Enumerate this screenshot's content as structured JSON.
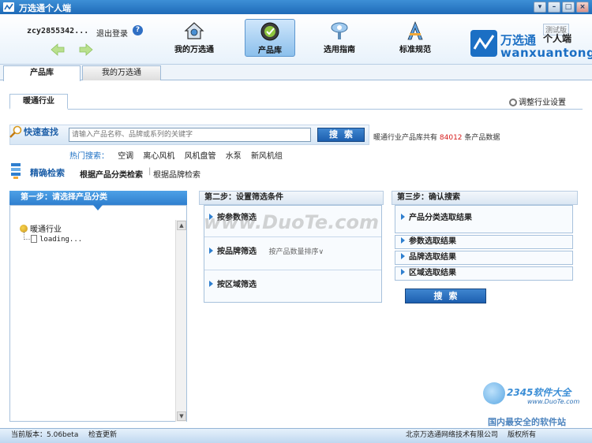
{
  "window": {
    "title": "万选通个人端"
  },
  "header": {
    "username": "zcy2855342...",
    "logout_label": "退出登录",
    "help_icon_glyph": "?",
    "nav": [
      {
        "label": "我的万选通",
        "icon": "home-icon"
      },
      {
        "label": "产品库",
        "icon": "product-library-icon",
        "active": true
      },
      {
        "label": "选用指南",
        "icon": "guide-icon"
      },
      {
        "label": "标准规范",
        "icon": "standard-icon"
      }
    ],
    "brand": {
      "tag": "测试版",
      "name_cn": "万选通",
      "name_cn2": "个人端",
      "name_en": "wanxuantong"
    }
  },
  "tabs": [
    {
      "label": "产品库",
      "active": true
    },
    {
      "label": "我的万选通"
    }
  ],
  "industry": {
    "tab_label": "暖通行业",
    "adjust_label": "调整行业设置"
  },
  "quick_search": {
    "label": "快速查找",
    "placeholder": "请输入产品名称、品牌或系列的关键字",
    "button_label": "搜索",
    "count_prefix": "暖通行业产品库共有",
    "count_value": "84012",
    "count_suffix": "条产品数据"
  },
  "hot_search": {
    "label": "热门搜索：",
    "keywords": [
      "空调",
      "离心风机",
      "风机盘管",
      "水泵",
      "新风机组"
    ]
  },
  "precise": {
    "label": "精确检索",
    "mode_category": "根据产品分类检索",
    "separator": "|",
    "mode_brand": "根据品牌检索"
  },
  "step1": {
    "title": "第一步：请选择产品分类",
    "tree_root": "暖通行业",
    "tree_child": "loading..."
  },
  "step2": {
    "title": "第二步：设置筛选条件",
    "filters": [
      "按参数筛选",
      "按品牌筛选",
      "按区域筛选"
    ],
    "sort_label": "按产品数量排序∨"
  },
  "step3": {
    "title": "第三步：确认搜索",
    "results": [
      "产品分类选取结果",
      "参数选取结果",
      "品牌选取结果",
      "区域选取结果"
    ],
    "button_label": "搜索"
  },
  "watermarks": {
    "duote": "www.DuoTe.com",
    "brand2": "2345软件大全",
    "url2": "www.DuoTe.com",
    "slogan": "国内最安全的软件站"
  },
  "status": {
    "version": "当前版本：5.06beta",
    "update_label": "检查更新",
    "company": "北京万选通网络技术有限公司",
    "rights": "版权所有"
  },
  "colors": {
    "accent": "#2f7fcf",
    "count_highlight": "#d61b1b"
  }
}
